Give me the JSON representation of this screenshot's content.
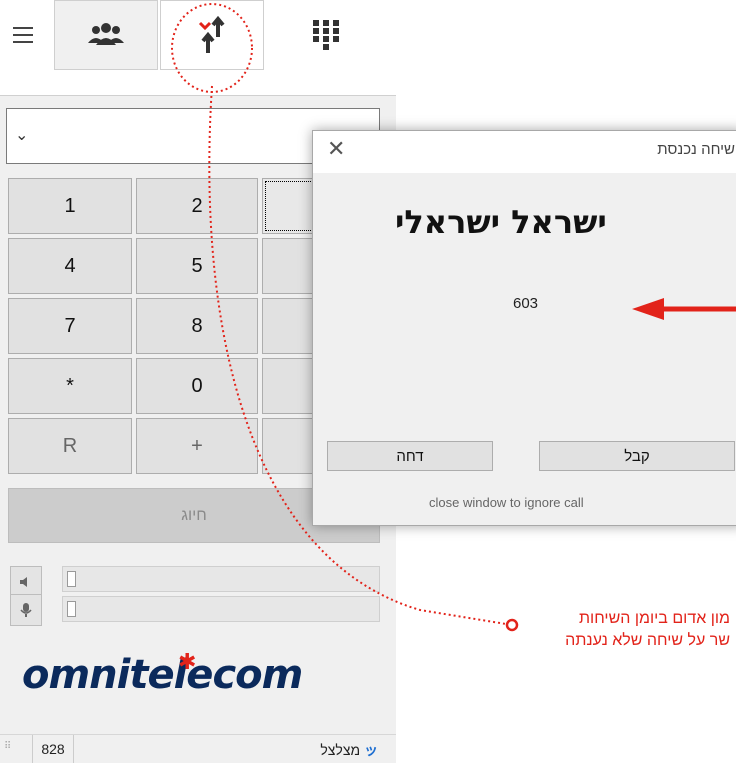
{
  "tabs": {
    "menu_icon": "hamburger-menu-icon",
    "contacts_icon": "contacts-icon",
    "calls_icon": "call-history-icon",
    "keypad_icon": "dialpad-icon"
  },
  "keypad": {
    "keys": [
      "1",
      "2",
      "",
      "4",
      "5",
      "",
      "7",
      "8",
      "",
      "*",
      "0",
      "",
      "R",
      "+",
      ""
    ],
    "dial_label": "חיוג"
  },
  "volume": {
    "speaker_icon": "speaker-icon",
    "mic_icon": "microphone-icon",
    "speaker_level": 0,
    "mic_level": 0
  },
  "logo": {
    "text": "omnitelecom"
  },
  "status": {
    "extension": "828",
    "state": "מצלצל"
  },
  "dialog": {
    "title": "שיחה נכנסת",
    "caller_name": "ישראל ישראלי",
    "caller_number": "603",
    "accept_label": "קבל",
    "reject_label": "דחה",
    "hint": "close window to ignore call"
  },
  "annotation": {
    "line1": "מון אדום ביומן השיחות",
    "line2": "שר על שיחה שלא נענתה"
  },
  "colors": {
    "annotation": "#e2231a",
    "logo": "#0b2a5c",
    "arrow": "#e2231a"
  }
}
